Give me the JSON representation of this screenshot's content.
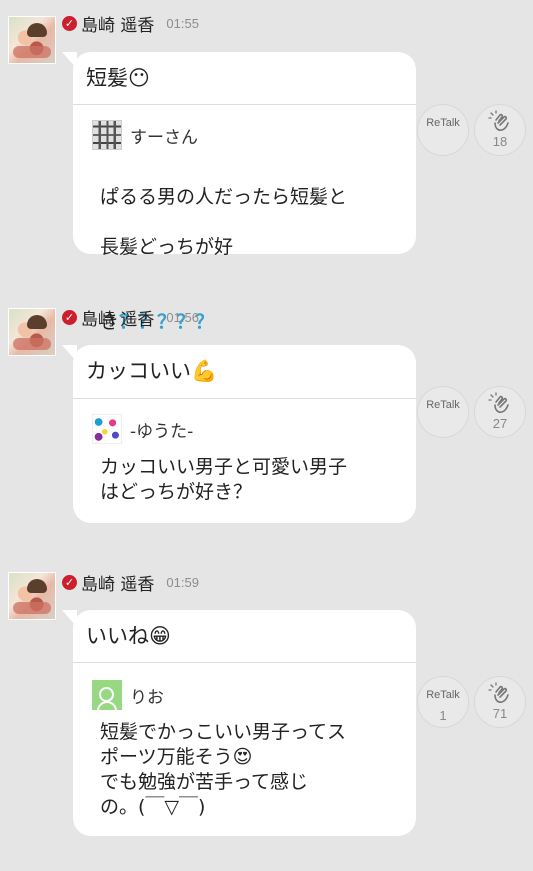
{
  "posts": [
    {
      "author": "島崎 遥香",
      "time": "01:55",
      "reply": "短髪😶",
      "question_user": "すーさん",
      "question_line1": "ぱるる男の人だったら短髪と",
      "question_line2": "長髪どっちが好",
      "question_line3_prefix": "き",
      "question_line3_suffix": "？？？？？",
      "retalk_label": "ReTalk",
      "retalk_count": "",
      "clap_count": "18"
    },
    {
      "author": "島崎 遥香",
      "time": "01:56",
      "reply": "カッコいい💪",
      "question_user": "-ゆうた-",
      "question_text": "カッコいい男子と可愛い男子\nはどっちが好き？",
      "retalk_label": "ReTalk",
      "retalk_count": "",
      "clap_count": "27"
    },
    {
      "author": "島崎 遥香",
      "time": "01:59",
      "reply": "いいね😁",
      "question_user": "りお",
      "question_text": "短髪でかっこいい男子ってス\nポーツ万能そう😍\nでも勉強が苦手って感じ\nの。(￣▽￣)",
      "retalk_label": "ReTalk",
      "retalk_count": "1",
      "clap_count": "71"
    }
  ],
  "icons": {
    "verified": "check-icon",
    "clap": "clap-icon"
  },
  "colors": {
    "background": "#e5e5e5",
    "bubble": "#ffffff",
    "verified": "#cc1f2d",
    "question_marks": "#33a1d1"
  }
}
